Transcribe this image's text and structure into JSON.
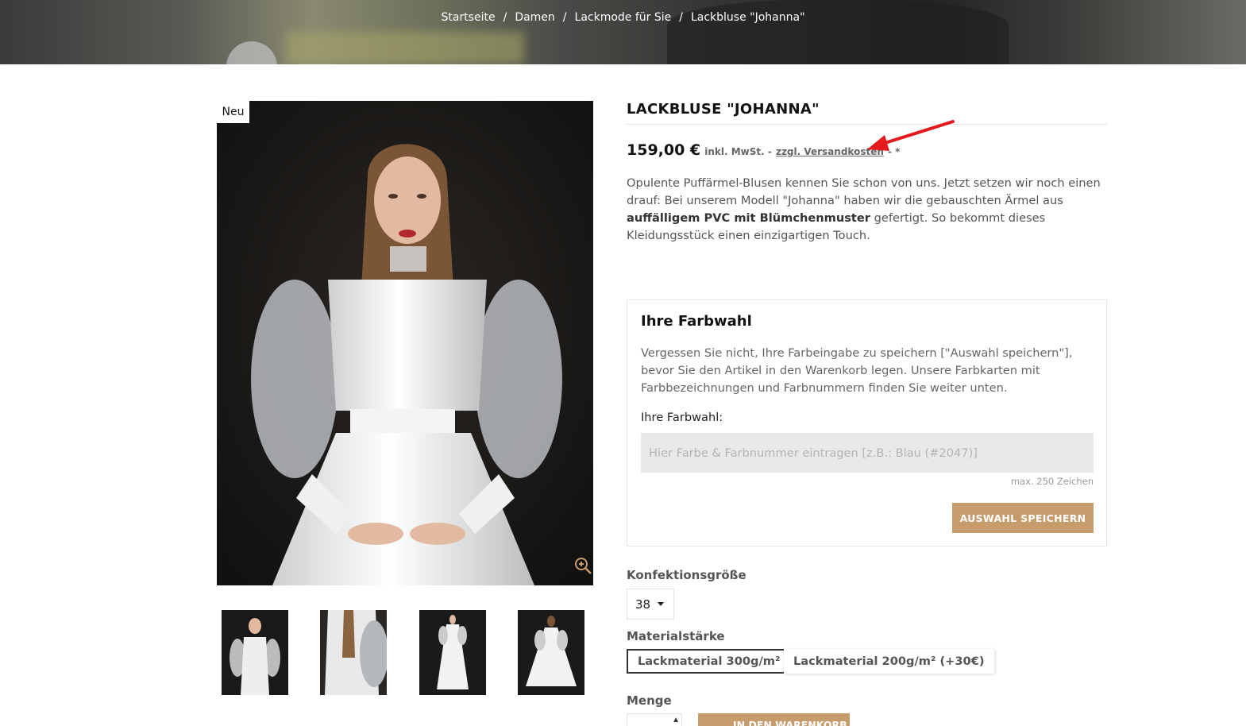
{
  "breadcrumb": {
    "items": [
      "Startseite",
      "Damen",
      "Lackmode für Sie",
      "Lackbluse \"Johanna\""
    ],
    "separator": "/"
  },
  "gallery": {
    "badge": "Neu",
    "zoom_icon": "zoom-in-icon",
    "thumbnail_count": 4
  },
  "product": {
    "title": "LACKBLUSE \"JOHANNA\"",
    "price": "159,00 €",
    "tax_note": "inkl. MwSt. -",
    "shipping_link": "zzgl. Versandkosten",
    "shipping_suffix": "- *",
    "description": {
      "part1": "Opulente Puffärmel-Blusen kennen Sie schon von uns. Jetzt setzen wir noch einen drauf: Bei unserem Modell \"Johanna\" haben wir die gebauschten Ärmel aus ",
      "bold": "auffälligem PVC mit Blümchenmuster",
      "part2": " gefertigt. So bekommt dieses Kleidungsstück einen einzigartigen Touch."
    }
  },
  "color_choice": {
    "heading": "Ihre Farbwahl",
    "hint": "Vergessen Sie nicht, Ihre Farbeingabe zu speichern [\"Auswahl speichern\"], bevor Sie den Artikel in den Warenkorb legen. Unsere Farbkarten mit Farbbezeichnungen und Farbnummern finden Sie weiter unten.",
    "field_label": "Ihre Farbwahl:",
    "placeholder": "Hier Farbe & Farbnummer eintragen [z.B.: Blau (#2047)]",
    "max_chars": "max. 250 Zeichen",
    "save_button": "AUSWAHL SPEICHERN"
  },
  "options": {
    "size_label": "Konfektionsgröße",
    "size_value": "38",
    "material_label": "Materialstärke",
    "materials": [
      "Lackmaterial 300g/m²",
      "Lackmaterial 200g/m² (+30€)"
    ],
    "selected_material": 0,
    "quantity_label": "Menge",
    "cart_button": "IN DEN WARENKORB"
  },
  "colors": {
    "accent": "#c69c6d",
    "annotation_arrow": "#e3191b"
  }
}
